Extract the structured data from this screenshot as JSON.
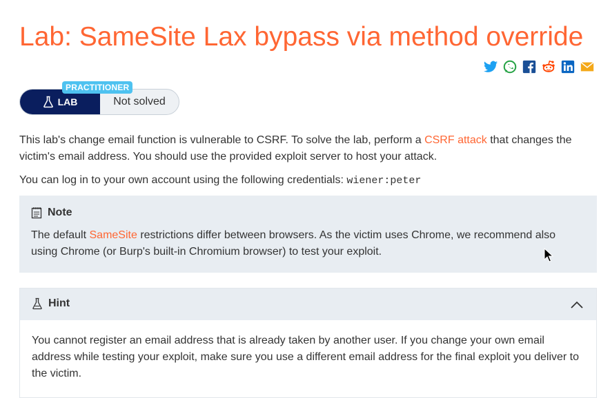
{
  "page": {
    "title": "Lab: SameSite Lax bypass via method override"
  },
  "share_icons": [
    "twitter-icon",
    "whatsapp-icon",
    "facebook-icon",
    "reddit-icon",
    "linkedin-icon",
    "email-icon"
  ],
  "status": {
    "tier": "PRACTITIONER",
    "lab_label": "LAB",
    "state": "Not solved"
  },
  "intro": {
    "p1_before": "This lab's change email function is vulnerable to CSRF. To solve the lab, perform a ",
    "p1_link": "CSRF attack",
    "p1_after": " that changes the victim's email address. You should use the provided exploit server to host your attack.",
    "p2_text": "You can log in to your own account using the following credentials: ",
    "p2_code": "wiener:peter"
  },
  "note": {
    "heading": "Note",
    "before": "The default ",
    "link": "SameSite",
    "after": " restrictions differ between browsers. As the victim uses Chrome, we recommend also using Chrome (or Burp's built-in Chromium browser) to test your exploit."
  },
  "hint": {
    "heading": "Hint",
    "text": "You cannot register an email address that is already taken by another user. If you change your own email address while testing your exploit, make sure you use a different email address for the final exploit you deliver to the victim."
  },
  "colors": {
    "accent": "#ff6633",
    "badge": "#4ec2f0",
    "lab_dark": "#0a1e5e",
    "box_bg": "#e8edf2"
  }
}
